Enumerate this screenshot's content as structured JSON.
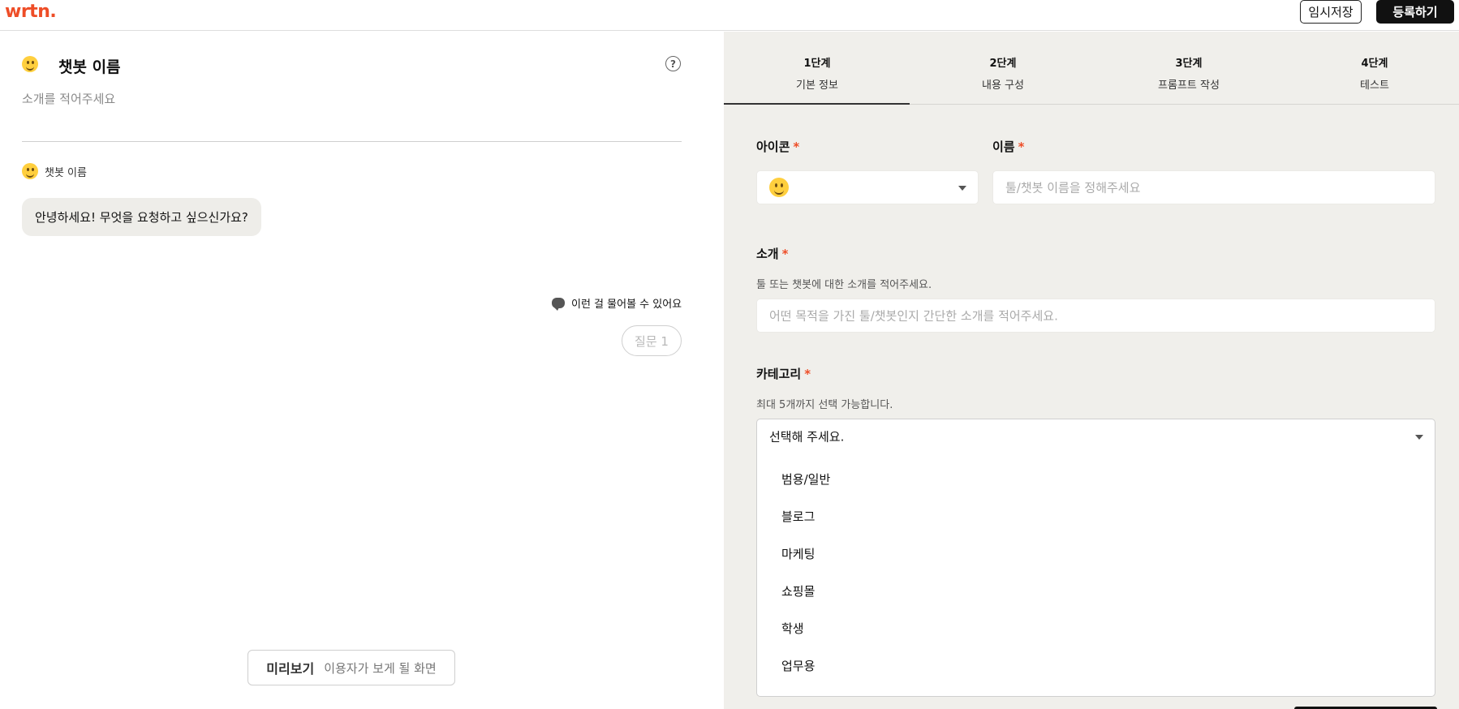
{
  "topbar": {
    "logo": "wrtn.",
    "draft_button": "임시저장",
    "register_button": "등록하기"
  },
  "preview": {
    "bot_name": "챗봇 이름",
    "intro_placeholder": "소개를 적어주세요",
    "message_sender": "챗봇 이름",
    "greeting": "안녕하세요! 무엇을 요청하고 싶으신가요?",
    "suggest_label": "이런 걸 물어볼 수 있어요",
    "question_chip": "질문 1",
    "preview_title": "미리보기",
    "preview_subtitle": "이용자가 보게 될 화면"
  },
  "steps": [
    {
      "num": "1단계",
      "label": "기본 정보",
      "active": true
    },
    {
      "num": "2단계",
      "label": "내용 구성",
      "active": false
    },
    {
      "num": "3단계",
      "label": "프롬프트 작성",
      "active": false
    },
    {
      "num": "4단계",
      "label": "테스트",
      "active": false
    }
  ],
  "form": {
    "icon_label": "아이콘",
    "name_label": "이름",
    "name_placeholder": "툴/챗봇 이름을 정해주세요",
    "intro_label": "소개",
    "intro_help": "툴 또는 챗봇에 대한 소개를 적어주세요.",
    "intro_placeholder": "어떤 목적을 가진 툴/챗봇인지 간단한 소개를 적어주세요.",
    "category_label": "카테고리",
    "category_help": "최대 5개까지 선택 가능합니다.",
    "category_select": "선택해 주세요.",
    "required_mark": "*",
    "category_options": [
      "범용/일반",
      "블로그",
      "마케팅",
      "쇼핑몰",
      "학생",
      "업무용"
    ]
  },
  "colors": {
    "brand": "#ee4d27",
    "panel_bg": "#f0efeb"
  },
  "icons": [
    "smile-emoji-icon",
    "help-circle-icon",
    "chat-bubble-icon",
    "chevron-down-icon"
  ]
}
